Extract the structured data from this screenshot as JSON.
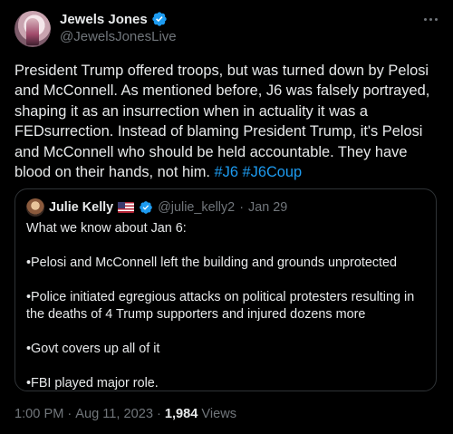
{
  "author": {
    "display_name": "Jewels Jones",
    "handle": "@JewelsJonesLive"
  },
  "icons": {
    "verified": "verified-badge-icon",
    "more": "more-options-icon",
    "flag": "us-flag-icon"
  },
  "colors": {
    "background": "#000000",
    "text": "#e7e9ea",
    "muted": "#71767b",
    "accent": "#1d9bf0",
    "border": "#2f3336"
  },
  "tweet": {
    "text": "President Trump offered troops, but was turned down by Pelosi and McConnell. As mentioned before, J6 was falsely portrayed, shaping it as an insurrection when in actuality it was a FEDsurrection. Instead of blaming President Trump, it's Pelosi and McConnell who should be held accountable. They have blood on their hands, not him.",
    "hashtags": [
      "#J6",
      "#J6Coup"
    ]
  },
  "quoted_tweet": {
    "display_name": "Julie Kelly",
    "handle": "@julie_kelly2",
    "separator": "·",
    "date": "Jan 29",
    "paragraphs": [
      "What we know about Jan 6:",
      "•Pelosi and McConnell left the building and grounds unprotected",
      "•Police initiated egregious attacks on political protesters resulting in the deaths of 4 Trump supporters and injured dozens more",
      "•Govt covers up all of it",
      "•FBI played major role."
    ]
  },
  "meta": {
    "time": "1:00 PM",
    "separator": "·",
    "date": "Aug 11, 2023",
    "separator2": "·",
    "views_count": "1,984",
    "views_label": "Views"
  }
}
